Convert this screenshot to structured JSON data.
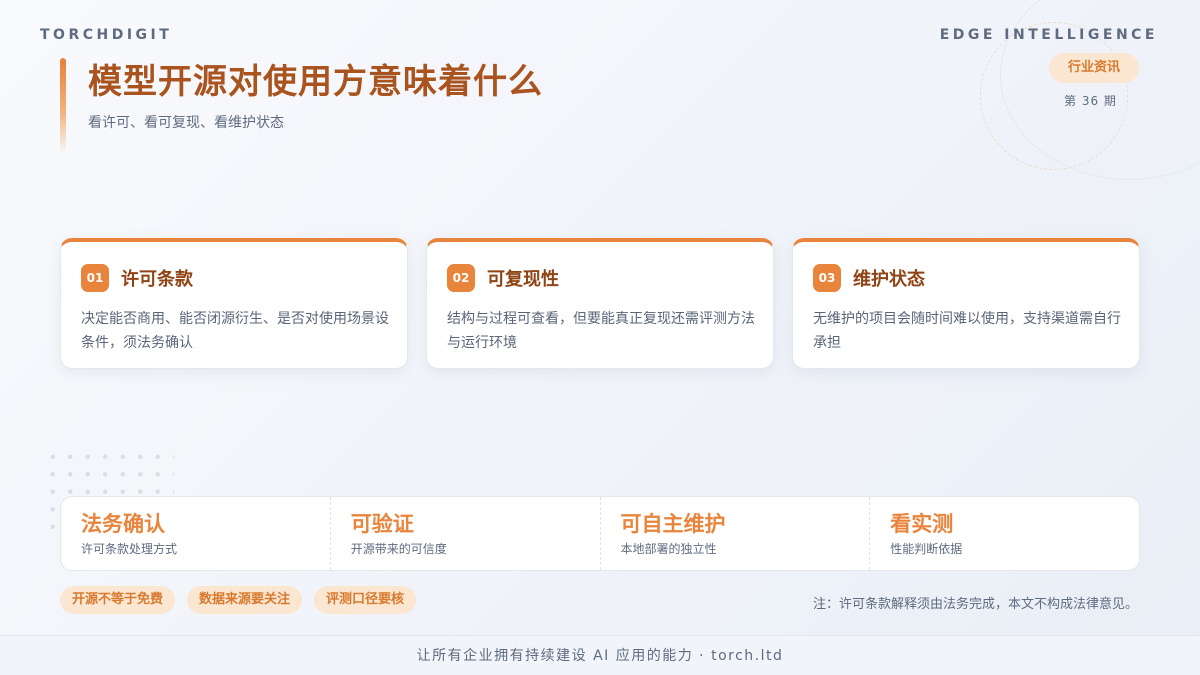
{
  "header": {
    "brand": "TORCHDIGIT",
    "tagline": "EDGE INTELLIGENCE",
    "category": "行业资讯",
    "issue": "第 36 期"
  },
  "hero": {
    "title": "模型开源对使用方意味着什么",
    "subtitle": "看许可、看可复现、看维护状态"
  },
  "cards": [
    {
      "num": "01",
      "title": "许可条款",
      "text": "决定能否商用、能否闭源衍生、是否对使用场景设条件，须法务确认"
    },
    {
      "num": "02",
      "title": "可复现性",
      "text": "结构与过程可查看，但要能真正复现还需评测方法与运行环境"
    },
    {
      "num": "03",
      "title": "维护状态",
      "text": "无维护的项目会随时间难以使用，支持渠道需自行承担"
    }
  ],
  "stats": [
    {
      "value": "法务确认",
      "label": "许可条款处理方式"
    },
    {
      "value": "可验证",
      "label": "开源带来的可信度"
    },
    {
      "value": "可自主维护",
      "label": "本地部署的独立性"
    },
    {
      "value": "看实测",
      "label": "性能判断依据"
    }
  ],
  "tags": [
    "开源不等于免费",
    "数据来源要关注",
    "评测口径要核"
  ],
  "note": "注：许可条款解释须由法务完成，本文不构成法律意见。",
  "footer": "让所有企业拥有持续建设 AI 应用的能力 · torch.ltd",
  "colors": {
    "accent": "#e8843c",
    "title": "#a9531e",
    "card_title": "#8f4416"
  }
}
